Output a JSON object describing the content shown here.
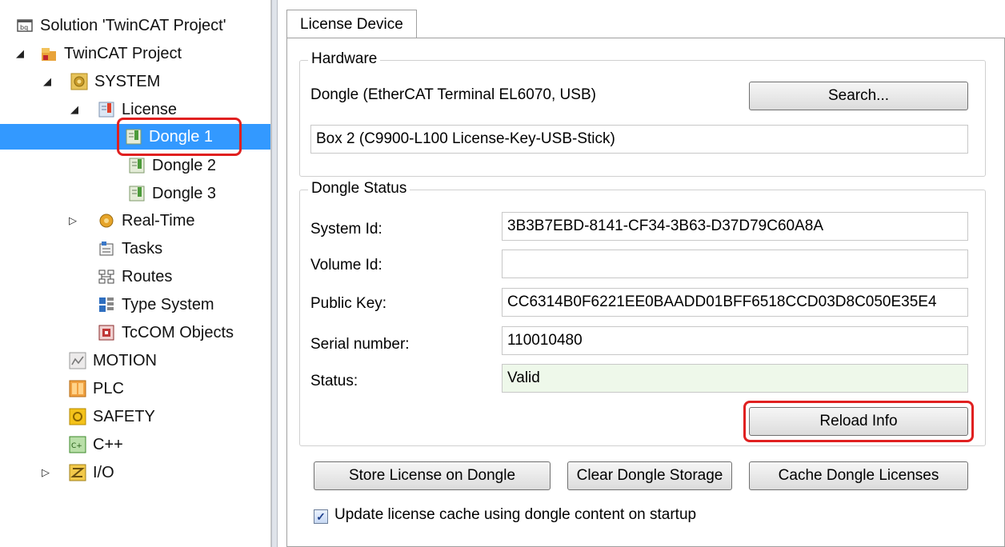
{
  "tree": {
    "items": [
      {
        "label": "Solution 'TwinCAT Project'",
        "icon": "solution-icon"
      },
      {
        "label": "TwinCAT Project",
        "icon": "twincat-project-icon",
        "expander": "expanded"
      },
      {
        "label": "SYSTEM",
        "icon": "system-gear-icon",
        "expander": "expanded"
      },
      {
        "label": "License",
        "icon": "license-icon",
        "expander": "expanded"
      },
      {
        "label": "Dongle 1",
        "icon": "dongle-icon",
        "selected": true
      },
      {
        "label": "Dongle 2",
        "icon": "dongle-icon"
      },
      {
        "label": "Dongle 3",
        "icon": "dongle-icon"
      },
      {
        "label": "Real-Time",
        "icon": "realtime-gear-icon",
        "expander": "collapsed"
      },
      {
        "label": "Tasks",
        "icon": "tasks-icon"
      },
      {
        "label": "Routes",
        "icon": "routes-icon"
      },
      {
        "label": "Type System",
        "icon": "type-system-icon"
      },
      {
        "label": "TcCOM Objects",
        "icon": "tccom-objects-icon"
      },
      {
        "label": "MOTION",
        "icon": "motion-icon"
      },
      {
        "label": "PLC",
        "icon": "plc-icon"
      },
      {
        "label": "SAFETY",
        "icon": "safety-icon"
      },
      {
        "label": "C++",
        "icon": "cpp-icon"
      },
      {
        "label": "I/O",
        "icon": "io-icon",
        "expander": "collapsed"
      }
    ]
  },
  "tab": {
    "label": "License Device"
  },
  "hardware": {
    "title": "Hardware",
    "dongle_label": "Dongle (EtherCAT Terminal EL6070, USB)",
    "search_button": "Search...",
    "box_value": "Box 2 (C9900-L100 License-Key-USB-Stick)"
  },
  "dongle_status": {
    "title": "Dongle Status",
    "system_id_label": "System Id:",
    "system_id_value": "3B3B7EBD-8141-CF34-3B63-D37D79C60A8A",
    "volume_id_label": "Volume Id:",
    "volume_id_value": "",
    "public_key_label": "Public Key:",
    "public_key_value": "CC6314B0F6221EE0BAADD01BFF6518CCD03D8C050E35E4",
    "serial_label": "Serial number:",
    "serial_value": "110010480",
    "status_label": "Status:",
    "status_value": "Valid",
    "reload_button": "Reload Info"
  },
  "actions": {
    "store_button": "Store License on Dongle",
    "clear_button": "Clear Dongle Storage",
    "cache_button": "Cache Dongle Licenses",
    "update_cache_checkbox_label": "Update license cache using dongle content on startup",
    "update_cache_checked": true
  },
  "colors": {
    "selection": "#3399ff",
    "highlight_outline": "#e02020",
    "status_valid_bg": "#eef8ea"
  }
}
